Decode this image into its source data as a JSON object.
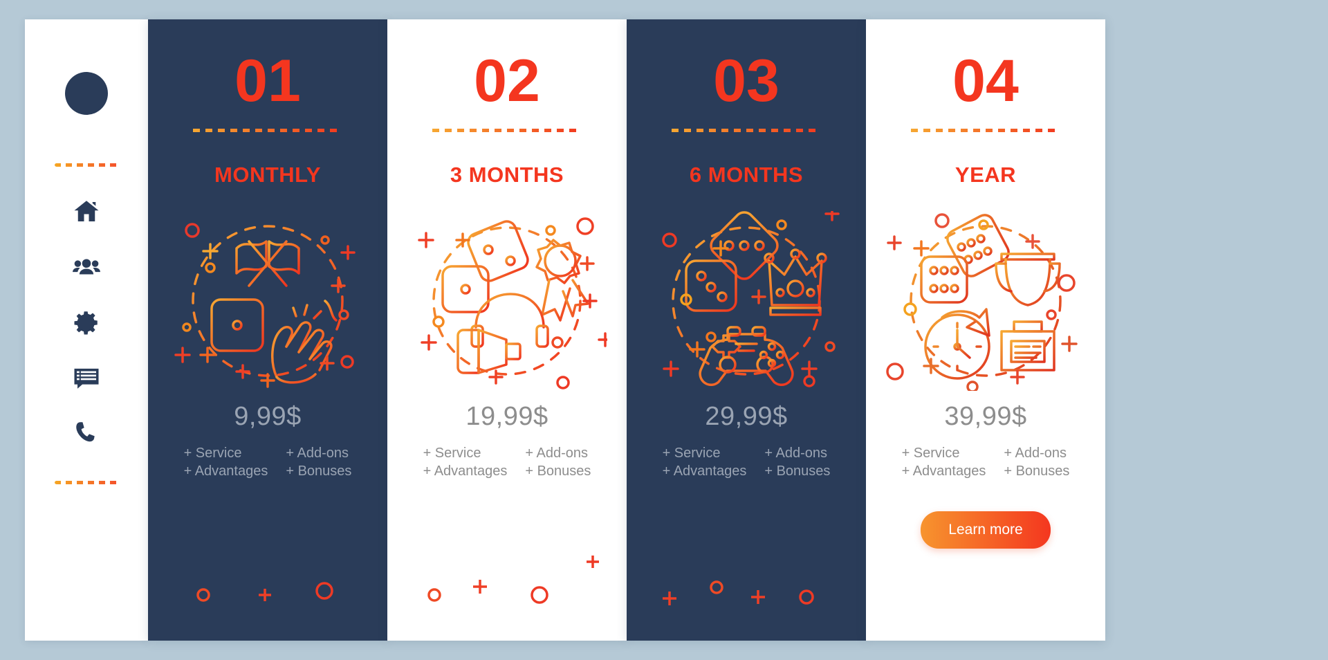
{
  "theme": {
    "page_bg": "#b5c9d6",
    "dark_card_bg": "#2a3c59",
    "light_card_bg": "#ffffff",
    "accent_red": "#f4361f",
    "accent_orange": "#f7942e",
    "muted_text": "#9aa4b3"
  },
  "sidebar": {
    "avatar_name": "avatar-dot",
    "icons": [
      {
        "name": "home-icon",
        "label": "Home"
      },
      {
        "name": "users-icon",
        "label": "Community"
      },
      {
        "name": "gear-icon",
        "label": "Settings"
      },
      {
        "name": "chat-list-icon",
        "label": "Messages"
      },
      {
        "name": "phone-icon",
        "label": "Contact"
      }
    ]
  },
  "cards": [
    {
      "number": "01",
      "title": "MONTHLY",
      "price": "9,99$",
      "features_left": [
        "+ Service",
        "+ Advantages"
      ],
      "features_right": [
        "+ Add-ons",
        "+ Bonuses"
      ],
      "theme": "dark",
      "illustration": "flags-dice-clapping-hands-illustration",
      "cta": null
    },
    {
      "number": "02",
      "title": "3 MONTHS",
      "price": "19,99$",
      "features_left": [
        "+ Service",
        "+ Advantages"
      ],
      "features_right": [
        "+ Add-ons",
        "+ Bonuses"
      ],
      "theme": "light",
      "illustration": "dice-award-vr-headset-illustration",
      "cta": null
    },
    {
      "number": "03",
      "title": "6 MONTHS",
      "price": "29,99$",
      "features_left": [
        "+ Service",
        "+ Advantages"
      ],
      "features_right": [
        "+ Add-ons",
        "+ Bonuses"
      ],
      "theme": "dark",
      "illustration": "dice-crown-gamepad-illustration",
      "cta": null
    },
    {
      "number": "04",
      "title": "YEAR",
      "price": "39,99$",
      "features_left": [
        "+ Service",
        "+ Advantages"
      ],
      "features_right": [
        "+ Add-ons",
        "+ Bonuses"
      ],
      "theme": "light",
      "illustration": "dice-trophy-clock-illustration",
      "cta": "Learn more"
    }
  ]
}
